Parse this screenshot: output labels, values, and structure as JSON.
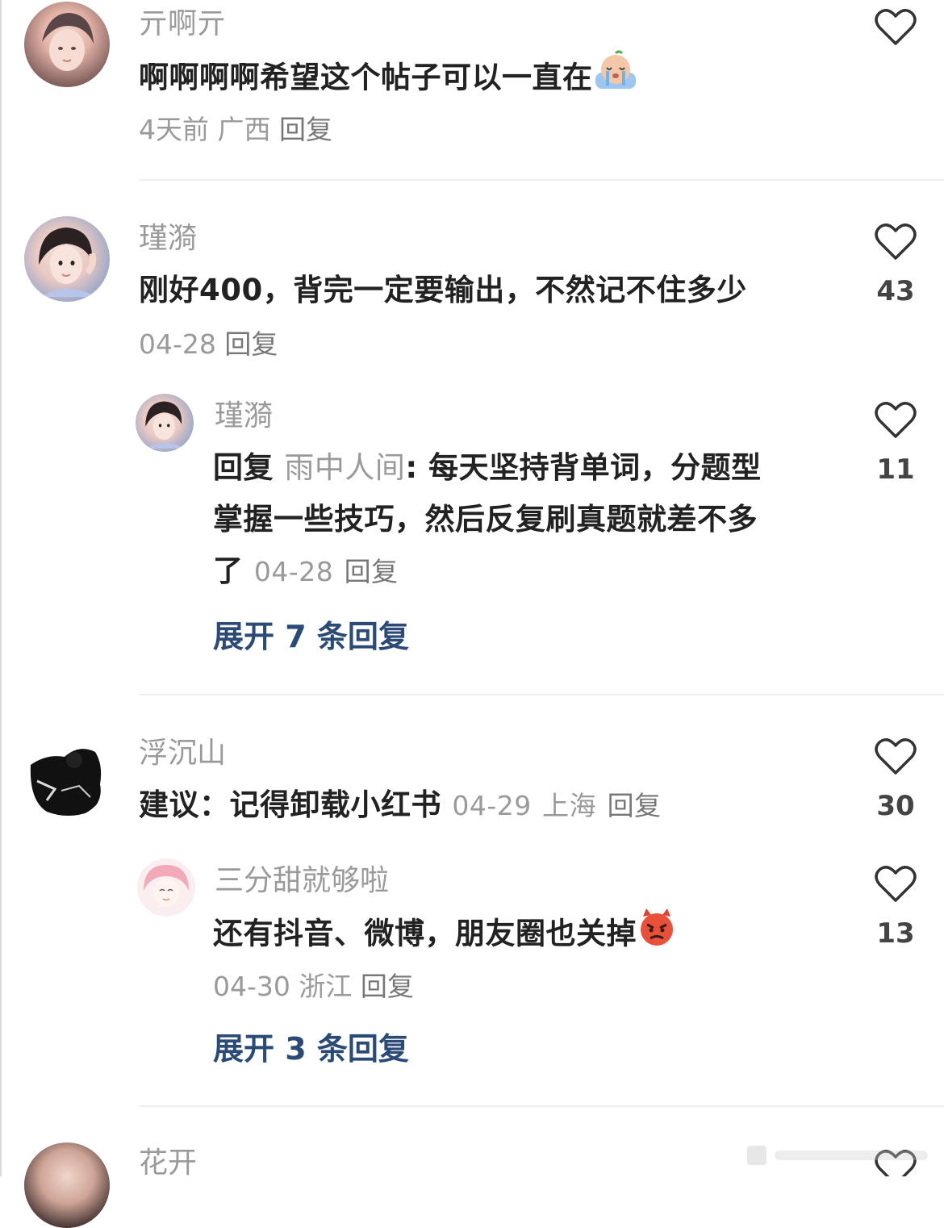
{
  "comments": [
    {
      "username": "亓啊亓",
      "text": "啊啊啊啊希望这个帖子可以一直在",
      "emoji": "crying-emoji",
      "time": "4天前",
      "location": "广西",
      "reply_label": "回复",
      "likes": ""
    },
    {
      "username": "瑾漪",
      "text": "刚好400，背完一定要输出，不然记不住多少",
      "time": "04-28",
      "reply_label": "回复",
      "likes": "43",
      "replies": [
        {
          "username": "瑾漪",
          "reply_prefix": "回复",
          "mention": "雨中人间",
          "text_line1": "每天坚持背单词，分题型",
          "text_line2": "掌握一些技巧，然后反复刷真题就差不多",
          "text_line3": "了",
          "time": "04-28",
          "reply_label": "回复",
          "likes": "11"
        }
      ],
      "expand_label": "展开 7 条回复"
    },
    {
      "username": "浮沉山",
      "text": "建议：记得卸载小红书",
      "time": "04-29",
      "location": "上海",
      "reply_label": "回复",
      "likes": "30",
      "replies": [
        {
          "username": "三分甜就够啦",
          "text": "还有抖音、微博，朋友圈也关掉",
          "emoji": "angry-devil-emoji",
          "time": "04-30",
          "location": "浙江",
          "reply_label": "回复",
          "likes": "13"
        }
      ],
      "expand_label": "展开 3 条回复"
    },
    {
      "username": "花开"
    }
  ],
  "colors": {
    "username": "#9a9a9a",
    "text": "#222222",
    "expand": "#2b4a76",
    "divider": "#efefef"
  },
  "icons": [
    "heart-outline-icon"
  ]
}
